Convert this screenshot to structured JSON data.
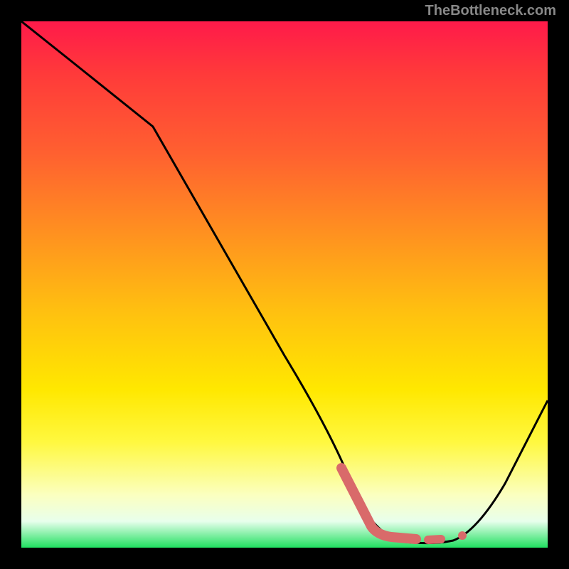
{
  "watermark": "TheBottleneck.com",
  "chart_data": {
    "type": "line",
    "title": "",
    "xlabel": "",
    "ylabel": "",
    "xlim": [
      0,
      100
    ],
    "ylim": [
      0,
      100
    ],
    "series": [
      {
        "name": "curve",
        "x": [
          0,
          10,
          25,
          60,
          66,
          72,
          78,
          82,
          88,
          100
        ],
        "y": [
          100,
          92,
          80,
          20,
          10,
          3,
          1,
          1,
          5,
          28
        ]
      }
    ],
    "annotations": {
      "highlight_segments": [
        {
          "x": [
            60,
            66
          ],
          "y": [
            13,
            3
          ]
        },
        {
          "x": [
            66,
            74
          ],
          "y": [
            3,
            1.5
          ]
        }
      ],
      "highlight_points": [
        {
          "x": 78,
          "y": 2
        },
        {
          "x": 82,
          "y": 2
        }
      ]
    },
    "colors": {
      "curve": "#000000",
      "highlight": "#d96a6a",
      "gradient_top": "#ff1a4a",
      "gradient_bottom": "#20e060"
    }
  }
}
